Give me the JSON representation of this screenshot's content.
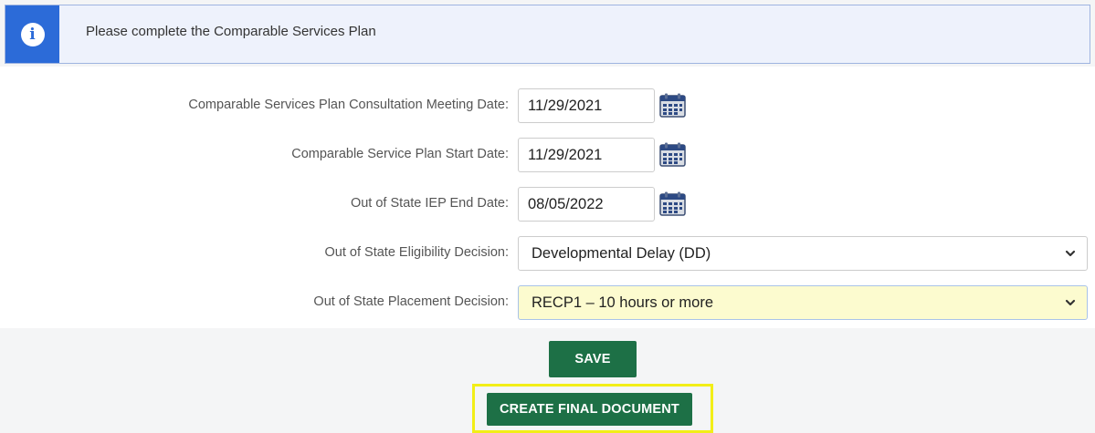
{
  "alert": {
    "icon": "info-icon",
    "icon_glyph": "i",
    "message": "Please complete the Comparable Services Plan",
    "accent_color": "#2c6bd8"
  },
  "form": {
    "consultation_date": {
      "label": "Comparable Services Plan Consultation Meeting Date:",
      "value": "11/29/2021"
    },
    "start_date": {
      "label": "Comparable Service Plan Start Date:",
      "value": "11/29/2021"
    },
    "iep_end_date": {
      "label": "Out of State IEP End Date:",
      "value": "08/05/2022"
    },
    "eligibility": {
      "label": "Out of State Eligibility Decision:",
      "selected": "Developmental Delay (DD)"
    },
    "placement": {
      "label": "Out of State Placement Decision:",
      "selected": "RECP1 – 10 hours or more",
      "highlight_color": "#fcfbcf"
    }
  },
  "actions": {
    "save_label": "SAVE",
    "create_final_label": "CREATE FINAL DOCUMENT",
    "button_color": "#1d7046",
    "focus_outline_color": "#f2ee17"
  }
}
